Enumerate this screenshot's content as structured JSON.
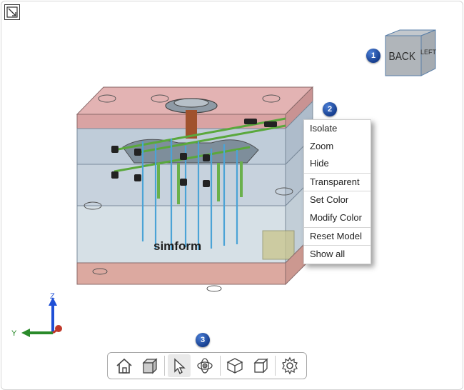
{
  "viewcube": {
    "front_face": "BACK",
    "side_face": "LEFT"
  },
  "badges": {
    "viewcube": "1",
    "context_menu": "2",
    "toolbar": "3"
  },
  "model": {
    "logo_text": "simform"
  },
  "context_menu": {
    "items": [
      {
        "label": "Isolate"
      },
      {
        "label": "Zoom"
      },
      {
        "label": "Hide"
      },
      {
        "label": "Transparent"
      },
      {
        "label": "Set Color"
      },
      {
        "label": "Modify Color"
      },
      {
        "label": "Reset Model"
      },
      {
        "label": "Show all"
      }
    ]
  },
  "axes": {
    "z": "Z",
    "y": "Y"
  },
  "toolbar": {
    "tools": [
      "home-icon",
      "cube-view-icon",
      "select-pointer-icon",
      "orbit-icon",
      "explode-icon",
      "section-box-icon",
      "settings-gear-icon"
    ]
  },
  "colors": {
    "badge": "#1f4fa8",
    "plate_red": "#d9a3a3",
    "plate_blue": "#b8c6d6",
    "pin_blue": "#4ba3d6",
    "pin_green": "#6ab04c",
    "sprue_brown": "#a0522d",
    "axis_z": "#1f4fd6",
    "axis_y": "#2a8a2a",
    "axis_x": "#c0392b"
  }
}
